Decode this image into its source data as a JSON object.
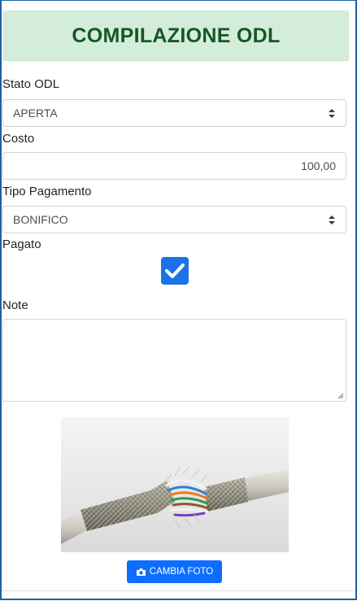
{
  "header": {
    "title": "COMPILAZIONE ODL"
  },
  "form": {
    "stato_label": "Stato ODL",
    "stato_value": "APERTA",
    "costo_label": "Costo",
    "costo_value": "100,00",
    "tipo_label": "Tipo Pagamento",
    "tipo_value": "BONIFICO",
    "pagato_label": "Pagato",
    "pagato_checked": true,
    "note_label": "Note",
    "note_value": ""
  },
  "photo": {
    "button_label": "CAMBIA FOTO"
  },
  "colors": {
    "header_bg": "#d4edda",
    "header_text": "#155724",
    "accent": "#1a73e8",
    "button_bg": "#0d6efd",
    "frame": "#1f5fa3"
  },
  "icons": [
    "caret-updown-icon",
    "check-icon",
    "resize-grip-icon",
    "camera-icon"
  ]
}
